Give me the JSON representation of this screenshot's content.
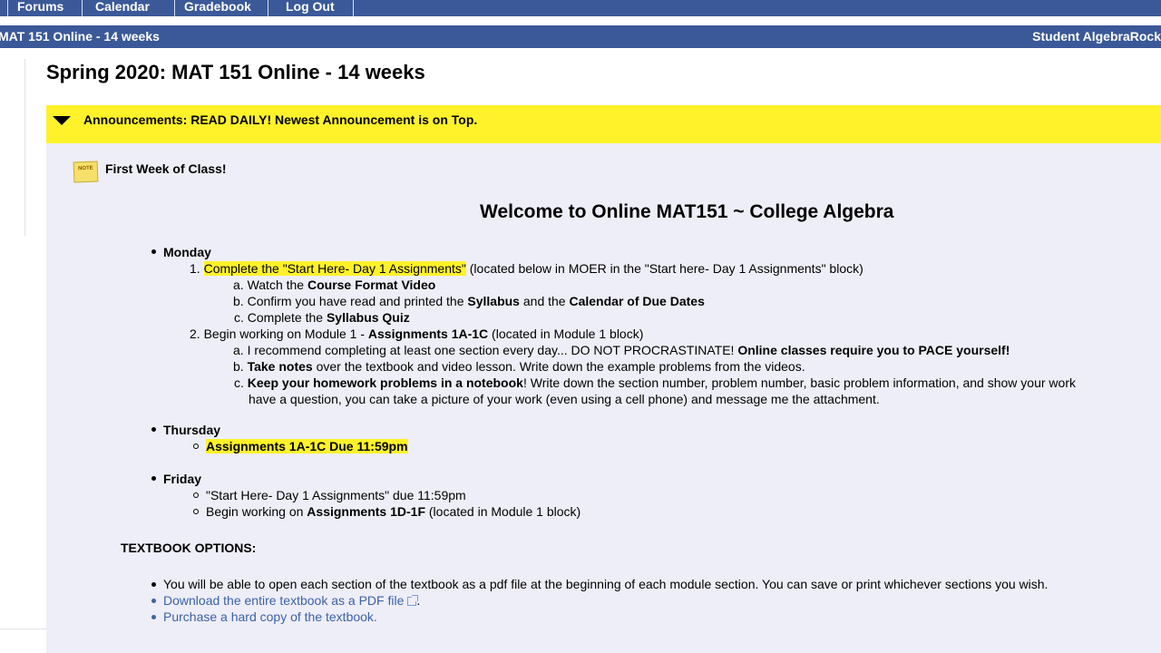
{
  "nav": {
    "items": [
      "Forums",
      "Calendar",
      "Gradebook",
      "Log Out"
    ]
  },
  "course_bar": {
    "course_name": "MAT 151 Online - 14 weeks",
    "user_name": "Student AlgebraRock"
  },
  "page_title": "Spring 2020: MAT 151 Online - 14 weeks",
  "announcements": {
    "title": "Announcements: READ DAILY! Newest Announcement is on Top.",
    "post_title": "First Week of Class!",
    "welcome": "Welcome to Online MAT151 ~ College Algebra",
    "note_icon_label": "NOTE",
    "monday": {
      "label": "Monday",
      "item1_num": "1.",
      "item1_highlight": "Complete the \"Start Here- Day 1 Assignments\"",
      "item1_rest": "(located below in MOER in the \"Start here- Day 1 Assignments\" block)",
      "item1_a_prefix": "a.",
      "item1_a_text": "Watch the ",
      "item1_a_bold": "Course Format Video",
      "item1_b_prefix": "b.",
      "item1_b_text1": "Confirm you have read and printed the ",
      "item1_b_bold1": "Syllabus",
      "item1_b_text2": " and the ",
      "item1_b_bold2": "Calendar of Due Dates",
      "item1_c_prefix": "c.",
      "item1_c_text": "Complete the ",
      "item1_c_bold": "Syllabus Quiz",
      "item2_num": "2.",
      "item2_text": "Begin working on Module 1 - ",
      "item2_bold": "Assignments 1A-1C",
      "item2_rest": "  (located in Module 1 block)",
      "item2_a_prefix": "a.",
      "item2_a_text": "I recommend completing at least one section every day... DO NOT PROCRASTINATE!  ",
      "item2_a_bold": "Online classes require you to PACE yourself!",
      "item2_b_prefix": "b.",
      "item2_b_bold": "Take notes",
      "item2_b_text": " over the textbook and video lesson.  Write down the example problems from the videos.",
      "item2_c_prefix": "c.",
      "item2_c_bold": "Keep your homework problems in a notebook",
      "item2_c_text": "!  Write down the section number, problem number, basic problem information, and show your work",
      "item2_c_text2": "have a question, you can take a picture of your work (even using a cell phone) and message me the attachment."
    },
    "thursday": {
      "label": "Thursday",
      "item1": "Assignments 1A-1C Due 11:59pm"
    },
    "friday": {
      "label": "Friday",
      "item1": "\"Start Here- Day 1 Assignments\" due 11:59pm",
      "item2_text": "Begin working on ",
      "item2_bold": "Assignments 1D-1F",
      "item2_rest": "  (located in Module 1 block)"
    },
    "textbook": {
      "heading": "TEXTBOOK OPTIONS:",
      "item1": "You will be able to open each section of the textbook as a pdf file at the beginning of each module section.  You can save or print whichever sections you wish.",
      "item2_link": "Download the entire textbook as a PDF file",
      "item2_after": ".",
      "item3_link": "Purchase a hard copy of the textbook."
    }
  }
}
